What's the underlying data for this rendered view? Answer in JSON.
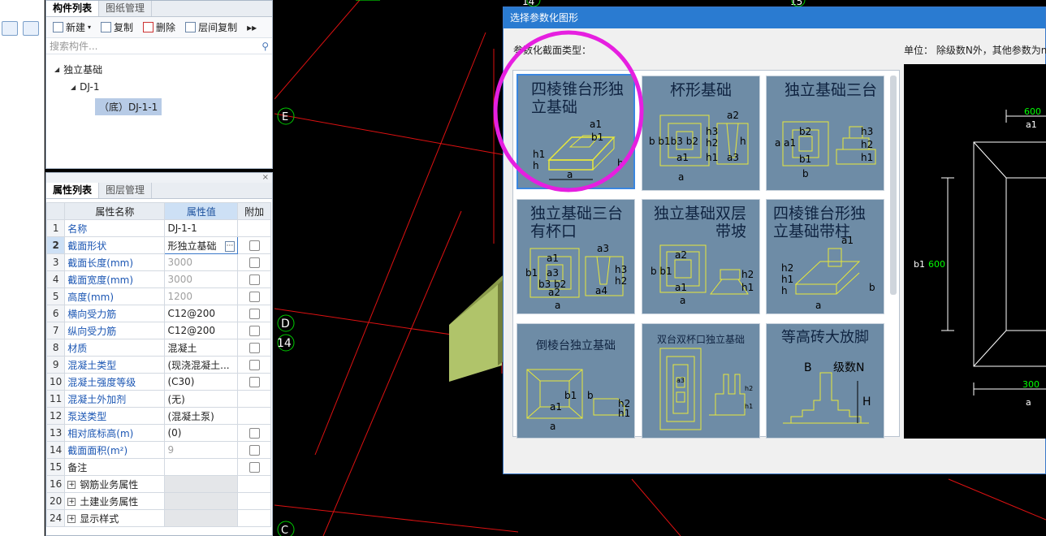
{
  "left_panel": {
    "tabs": [
      "构件列表",
      "图纸管理"
    ],
    "toolbar": {
      "new": "新建",
      "copy": "复制",
      "delete": "删除",
      "floor_copy": "层间复制"
    },
    "search_placeholder": "搜索构件...",
    "tree": {
      "root": "独立基础",
      "child": "DJ-1",
      "leaf": "（底）DJ-1-1"
    }
  },
  "prop_panel": {
    "tabs": [
      "属性列表",
      "图层管理"
    ],
    "headers": {
      "name": "属性名称",
      "value": "属性值",
      "extra": "附加"
    },
    "rows": [
      {
        "n": "1",
        "name": "名称",
        "value": "DJ-1-1"
      },
      {
        "n": "2",
        "name": "截面形状",
        "value": "形独立基础"
      },
      {
        "n": "3",
        "name": "截面长度(mm)",
        "value": "3000"
      },
      {
        "n": "4",
        "name": "截面宽度(mm)",
        "value": "3000"
      },
      {
        "n": "5",
        "name": "高度(mm)",
        "value": "1200"
      },
      {
        "n": "6",
        "name": "横向受力筋",
        "value": "C12@200"
      },
      {
        "n": "7",
        "name": "纵向受力筋",
        "value": "C12@200"
      },
      {
        "n": "8",
        "name": "材质",
        "value": "混凝土"
      },
      {
        "n": "9",
        "name": "混凝土类型",
        "value": "(现浇混凝土..."
      },
      {
        "n": "10",
        "name": "混凝土强度等级",
        "value": "(C30)"
      },
      {
        "n": "11",
        "name": "混凝土外加剂",
        "value": "(无)"
      },
      {
        "n": "12",
        "name": "泵送类型",
        "value": "(混凝土泵)"
      },
      {
        "n": "13",
        "name": "相对底标高(m)",
        "value": "(0)"
      },
      {
        "n": "14",
        "name": "截面面积(m²)",
        "value": "9"
      },
      {
        "n": "15",
        "name": "备注",
        "value": ""
      },
      {
        "n": "16",
        "name": "钢筋业务属性",
        "value": ""
      },
      {
        "n": "20",
        "name": "土建业务属性",
        "value": ""
      },
      {
        "n": "24",
        "name": "显示样式",
        "value": ""
      }
    ]
  },
  "canvas": {
    "labels": {
      "e": "E",
      "d": "D",
      "c": "C",
      "d_num": "14",
      "top1": "14",
      "top2": "15"
    }
  },
  "dialog": {
    "title": "选择参数化图形",
    "section_label": "参数化截面类型：",
    "unit_text": "单位：  除级数N外，其他参数为m",
    "shapes": [
      {
        "title": "四棱锥台形独立基础"
      },
      {
        "title": "杯形基础"
      },
      {
        "title": "独立基础三台"
      },
      {
        "title": "独立基础三台有杯口"
      },
      {
        "title": "独立基础双层带坡"
      },
      {
        "title": "四棱锥台形独立基础带柱"
      },
      {
        "title": "倒棱台独立基础"
      },
      {
        "title": "双台双杯口独立基础"
      },
      {
        "title": "等高砖大放脚"
      }
    ],
    "preview": {
      "top_val": "600",
      "top_lbl": "a1",
      "side_lbl": "b1",
      "side_val": "600",
      "bot_val": "300",
      "bot_lbl": "a"
    }
  },
  "colors": {
    "accent": "#2a7bd1",
    "highlight": "#e61fe0",
    "drawing": "#e8e83a",
    "cad_bg": "#000000"
  }
}
